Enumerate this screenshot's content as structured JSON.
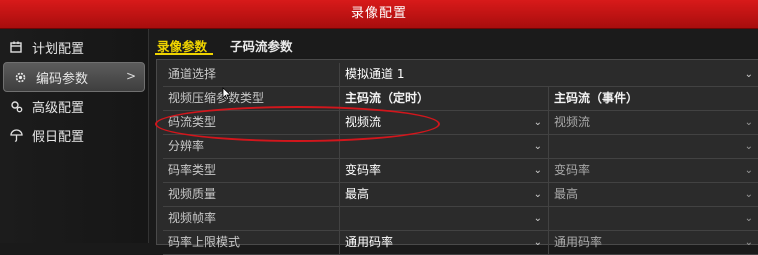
{
  "window": {
    "title": "录像配置"
  },
  "sidebar": {
    "items": [
      {
        "label": "计划配置",
        "icon": "calendar-icon"
      },
      {
        "label": "编码参数",
        "icon": "gear-icon",
        "active": true
      },
      {
        "label": "高级配置",
        "icon": "settings-icon"
      },
      {
        "label": "假日配置",
        "icon": "umbrella-icon"
      }
    ],
    "active_arrow": ">"
  },
  "tabs": [
    {
      "label": "录像参数",
      "active": true
    },
    {
      "label": "子码流参数",
      "active": false
    }
  ],
  "channel": {
    "label": "通道选择",
    "value": "模拟通道 1"
  },
  "header": {
    "label": "视频压缩参数类型",
    "col1": "主码流（定时）",
    "col2": "主码流（事件）"
  },
  "rows": [
    {
      "label": "码流类型",
      "col1": "视频流",
      "col2": "视频流"
    },
    {
      "label": "分辨率",
      "col1": "",
      "col2": ""
    },
    {
      "label": "码率类型",
      "col1": "变码率",
      "col2": "变码率"
    },
    {
      "label": "视频质量",
      "col1": "最高",
      "col2": "最高"
    },
    {
      "label": "视频帧率",
      "col1": "",
      "col2": ""
    },
    {
      "label": "码率上限模式",
      "col1": "通用码率",
      "col2": "通用码率"
    }
  ],
  "colors": {
    "title_bar": "#c01010",
    "active_tab": "#f0d400",
    "highlight_annotation": "#d2161c"
  }
}
